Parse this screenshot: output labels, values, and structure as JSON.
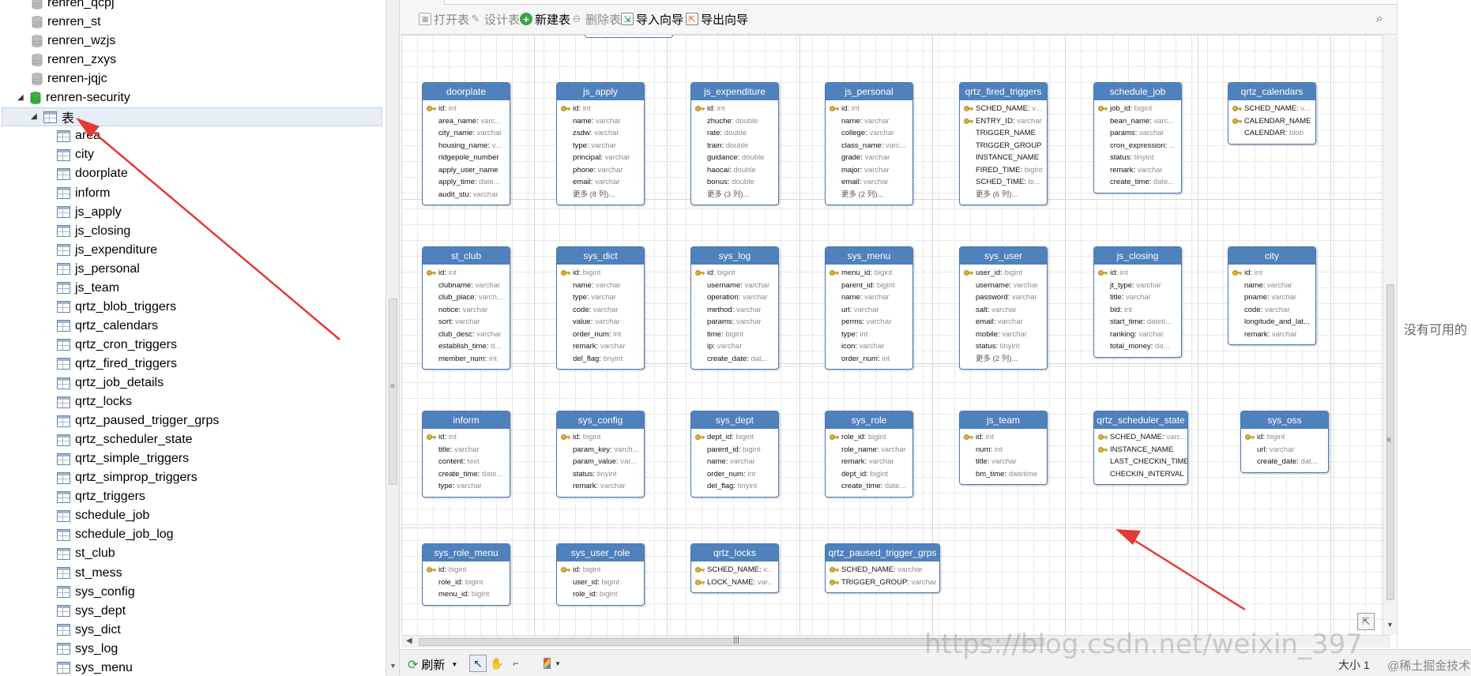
{
  "tree": {
    "databases_above": [
      "renren_qcpj",
      "renren_st",
      "renren_wzjs",
      "renren_zxys",
      "renren-jqjc"
    ],
    "active_database": "renren-security",
    "tables_folder": "表",
    "tables": [
      "area",
      "city",
      "doorplate",
      "inform",
      "js_apply",
      "js_closing",
      "js_expenditure",
      "js_personal",
      "js_team",
      "qrtz_blob_triggers",
      "qrtz_calendars",
      "qrtz_cron_triggers",
      "qrtz_fired_triggers",
      "qrtz_job_details",
      "qrtz_locks",
      "qrtz_paused_trigger_grps",
      "qrtz_scheduler_state",
      "qrtz_simple_triggers",
      "qrtz_simprop_triggers",
      "qrtz_triggers",
      "schedule_job",
      "schedule_job_log",
      "st_club",
      "st_mess",
      "sys_config",
      "sys_dept",
      "sys_dict",
      "sys_log",
      "sys_menu"
    ]
  },
  "toolbar": {
    "open_table": "打开表",
    "design_table": "设计表",
    "new_table": "新建表",
    "delete_table": "删除表",
    "import_wizard": "导入向导",
    "export_wizard": "导出向导"
  },
  "entities": [
    {
      "name": "doorplate",
      "fields": [
        [
          "id",
          "int",
          true
        ],
        [
          "area_name",
          "varc...",
          false
        ],
        [
          "city_name",
          "varchar",
          false
        ],
        [
          "housing_name",
          "v...",
          false
        ],
        [
          "ridgepole_number",
          "",
          false
        ],
        [
          "apply_user_name",
          "",
          false
        ],
        [
          "apply_time",
          "date...",
          false
        ],
        [
          "audit_stu",
          "varchar",
          false
        ]
      ]
    },
    {
      "name": "js_apply",
      "fields": [
        [
          "id",
          "int",
          true
        ],
        [
          "name",
          "varchar",
          false
        ],
        [
          "zsdw",
          "varchar",
          false
        ],
        [
          "type",
          "varchar",
          false
        ],
        [
          "principal",
          "varchar",
          false
        ],
        [
          "phone",
          "varchar",
          false
        ],
        [
          "email",
          "varchar",
          false
        ]
      ],
      "more": "更多 (8 列)..."
    },
    {
      "name": "js_expenditure",
      "fields": [
        [
          "id",
          "int",
          true
        ],
        [
          "zhuche",
          "double",
          false
        ],
        [
          "rate",
          "double",
          false
        ],
        [
          "train",
          "double",
          false
        ],
        [
          "guidance",
          "double",
          false
        ],
        [
          "haocai",
          "double",
          false
        ],
        [
          "bonus",
          "double",
          false
        ]
      ],
      "more": "更多 (3 列)..."
    },
    {
      "name": "js_personal",
      "fields": [
        [
          "id",
          "int",
          true
        ],
        [
          "name",
          "varchar",
          false
        ],
        [
          "college",
          "varchar",
          false
        ],
        [
          "class_name",
          "varc...",
          false
        ],
        [
          "grade",
          "varchar",
          false
        ],
        [
          "major",
          "varchar",
          false
        ],
        [
          "email",
          "varchar",
          false
        ]
      ],
      "more": "更多 (2 列)..."
    },
    {
      "name": "qrtz_fired_triggers",
      "fields": [
        [
          "SCHED_NAME",
          "v...",
          true
        ],
        [
          "ENTRY_ID",
          "varchar",
          true
        ],
        [
          "TRIGGER_NAME",
          "",
          false
        ],
        [
          "TRIGGER_GROUP",
          "",
          false
        ],
        [
          "INSTANCE_NAME",
          "",
          false
        ],
        [
          "FIRED_TIME",
          "bigint",
          false
        ],
        [
          "SCHED_TIME",
          "bi...",
          false
        ]
      ],
      "more": "更多 (6 列)..."
    },
    {
      "name": "schedule_job",
      "fields": [
        [
          "job_id",
          "bigint",
          true
        ],
        [
          "bean_name",
          "varc...",
          false
        ],
        [
          "params",
          "varchar",
          false
        ],
        [
          "cron_expression",
          "...",
          false
        ],
        [
          "status",
          "tinyint",
          false
        ],
        [
          "remark",
          "varchar",
          false
        ],
        [
          "create_time",
          "date...",
          false
        ]
      ]
    },
    {
      "name": "qrtz_calendars",
      "fields": [
        [
          "SCHED_NAME",
          "v...",
          true
        ],
        [
          "CALENDAR_NAME",
          "",
          true
        ],
        [
          "CALENDAR",
          "blob",
          false
        ]
      ]
    },
    {
      "name": "st_club",
      "fields": [
        [
          "id",
          "int",
          true
        ],
        [
          "clubname",
          "varchar",
          false
        ],
        [
          "club_place",
          "varch...",
          false
        ],
        [
          "notice",
          "varchar",
          false
        ],
        [
          "sort",
          "varchar",
          false
        ],
        [
          "club_desc",
          "varchar",
          false
        ],
        [
          "establish_time",
          "d...",
          false
        ],
        [
          "member_num",
          "int",
          false
        ]
      ]
    },
    {
      "name": "sys_dict",
      "fields": [
        [
          "id",
          "bigint",
          true
        ],
        [
          "name",
          "varchar",
          false
        ],
        [
          "type",
          "varchar",
          false
        ],
        [
          "code",
          "varchar",
          false
        ],
        [
          "value",
          "varchar",
          false
        ],
        [
          "order_num",
          "int",
          false
        ],
        [
          "remark",
          "varchar",
          false
        ],
        [
          "del_flag",
          "tinyint",
          false
        ]
      ]
    },
    {
      "name": "sys_log",
      "fields": [
        [
          "id",
          "bigint",
          true
        ],
        [
          "username",
          "varchar",
          false
        ],
        [
          "operation",
          "varchar",
          false
        ],
        [
          "method",
          "varchar",
          false
        ],
        [
          "params",
          "varchar",
          false
        ],
        [
          "time",
          "bigint",
          false
        ],
        [
          "ip",
          "varchar",
          false
        ],
        [
          "create_date",
          "dat...",
          false
        ]
      ]
    },
    {
      "name": "sys_menu",
      "fields": [
        [
          "menu_id",
          "bigint",
          true
        ],
        [
          "parent_id",
          "bigint",
          false
        ],
        [
          "name",
          "varchar",
          false
        ],
        [
          "url",
          "varchar",
          false
        ],
        [
          "perms",
          "varchar",
          false
        ],
        [
          "type",
          "int",
          false
        ],
        [
          "icon",
          "varchar",
          false
        ],
        [
          "order_num",
          "int",
          false
        ]
      ]
    },
    {
      "name": "sys_user",
      "fields": [
        [
          "user_id",
          "bigint",
          true
        ],
        [
          "username",
          "varchar",
          false
        ],
        [
          "password",
          "varchar",
          false
        ],
        [
          "salt",
          "varchar",
          false
        ],
        [
          "email",
          "varchar",
          false
        ],
        [
          "mobile",
          "varchar",
          false
        ],
        [
          "status",
          "tinyint",
          false
        ]
      ],
      "more": "更多 (2 列)..."
    },
    {
      "name": "js_closing",
      "fields": [
        [
          "id",
          "int",
          true
        ],
        [
          "jt_type",
          "varchar",
          false
        ],
        [
          "title",
          "varchar",
          false
        ],
        [
          "bid",
          "int",
          false
        ],
        [
          "start_time",
          "dateti...",
          false
        ],
        [
          "ranking",
          "varchar",
          false
        ],
        [
          "total_money",
          "do...",
          false
        ]
      ]
    },
    {
      "name": "city",
      "fields": [
        [
          "id",
          "int",
          true
        ],
        [
          "name",
          "varchar",
          false
        ],
        [
          "pname",
          "varchar",
          false
        ],
        [
          "code",
          "varchar",
          false
        ],
        [
          "longitude_and_lat...",
          "",
          false
        ],
        [
          "remark",
          "varchar",
          false
        ]
      ]
    },
    {
      "name": "inform",
      "fields": [
        [
          "id",
          "int",
          true
        ],
        [
          "title",
          "varchar",
          false
        ],
        [
          "content",
          "text",
          false
        ],
        [
          "create_time",
          "date...",
          false
        ],
        [
          "type",
          "varchar",
          false
        ]
      ]
    },
    {
      "name": "sys_config",
      "fields": [
        [
          "id",
          "bigint",
          true
        ],
        [
          "param_key",
          "varch...",
          false
        ],
        [
          "param_value",
          "var...",
          false
        ],
        [
          "status",
          "tinyint",
          false
        ],
        [
          "remark",
          "varchar",
          false
        ]
      ]
    },
    {
      "name": "sys_dept",
      "fields": [
        [
          "dept_id",
          "bigint",
          true
        ],
        [
          "parent_id",
          "bigint",
          false
        ],
        [
          "name",
          "varchar",
          false
        ],
        [
          "order_num",
          "int",
          false
        ],
        [
          "del_flag",
          "tinyint",
          false
        ]
      ]
    },
    {
      "name": "sys_role",
      "fields": [
        [
          "role_id",
          "bigint",
          true
        ],
        [
          "role_name",
          "varchar",
          false
        ],
        [
          "remark",
          "varchar",
          false
        ],
        [
          "dept_id",
          "bigint",
          false
        ],
        [
          "create_time",
          "date...",
          false
        ]
      ]
    },
    {
      "name": "js_team",
      "fields": [
        [
          "id",
          "int",
          true
        ],
        [
          "num",
          "int",
          false
        ],
        [
          "title",
          "varchar",
          false
        ],
        [
          "bm_time",
          "datetime",
          false
        ]
      ]
    },
    {
      "name": "qrtz_scheduler_state",
      "fields": [
        [
          "SCHED_NAME",
          "varc...",
          true
        ],
        [
          "INSTANCE_NAME",
          "",
          true
        ],
        [
          "LAST_CHECKIN_TIME",
          "",
          false
        ],
        [
          "CHECKIN_INTERVAL",
          "",
          false
        ]
      ]
    },
    {
      "name": "sys_oss",
      "fields": [
        [
          "id",
          "bigint",
          true
        ],
        [
          "url",
          "varchar",
          false
        ],
        [
          "create_date",
          "dat...",
          false
        ]
      ]
    },
    {
      "name": "sys_role_menu",
      "fields": [
        [
          "id",
          "bigint",
          true
        ],
        [
          "role_id",
          "bigint",
          false
        ],
        [
          "menu_id",
          "bigint",
          false
        ]
      ]
    },
    {
      "name": "sys_user_role",
      "fields": [
        [
          "id",
          "bigint",
          true
        ],
        [
          "user_id",
          "bigint",
          false
        ],
        [
          "role_id",
          "bigint",
          false
        ]
      ]
    },
    {
      "name": "qrtz_locks",
      "fields": [
        [
          "SCHED_NAME",
          "v...",
          true
        ],
        [
          "LOCK_NAME",
          "var...",
          true
        ]
      ]
    },
    {
      "name": "qrtz_paused_trigger_grps",
      "fields": [
        [
          "SCHED_NAME",
          "varchar",
          true
        ],
        [
          "TRIGGER_GROUP",
          "varchar",
          true
        ]
      ]
    }
  ],
  "statusbar": {
    "refresh": "刷新",
    "zoom_label": "大小 1"
  },
  "side_pane": {
    "empty_text": "没有可用的"
  },
  "watermark": {
    "url": "https://blog.csdn.net/weixin_397",
    "community": "@稀土掘金技术社区"
  },
  "colors": {
    "entity_header": "#4f81bd",
    "annotation_arrow": "#e53935",
    "refresh_icon": "#2e9a3a",
    "key_icon": "#d9a520"
  }
}
